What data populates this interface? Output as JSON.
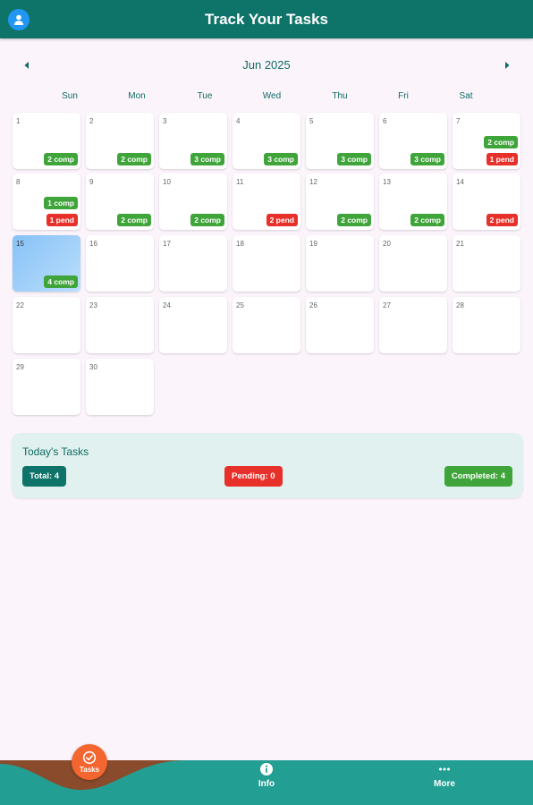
{
  "appbar": {
    "title": "Track Your Tasks",
    "avatar_icon": "person-icon"
  },
  "calendar": {
    "month_label": "Jun 2025",
    "prev_icon": "chevron-left-icon",
    "next_icon": "chevron-right-icon",
    "weekdays": [
      "Sun",
      "Mon",
      "Tue",
      "Wed",
      "Thu",
      "Fri",
      "Sat"
    ],
    "days": [
      {
        "day": "1",
        "comp": "2 comp"
      },
      {
        "day": "2",
        "comp": "2 comp"
      },
      {
        "day": "3",
        "comp": "3 comp"
      },
      {
        "day": "4",
        "comp": "3 comp"
      },
      {
        "day": "5",
        "comp": "3 comp"
      },
      {
        "day": "6",
        "comp": "3 comp"
      },
      {
        "day": "7",
        "comp": "2 comp",
        "pend": "1 pend"
      },
      {
        "day": "8",
        "comp": "1 comp",
        "pend": "1 pend"
      },
      {
        "day": "9",
        "comp": "2 comp"
      },
      {
        "day": "10",
        "comp": "2 comp"
      },
      {
        "day": "11",
        "pend": "2 pend"
      },
      {
        "day": "12",
        "comp": "2 comp"
      },
      {
        "day": "13",
        "comp": "2 comp"
      },
      {
        "day": "14",
        "pend": "2 pend"
      },
      {
        "day": "15",
        "comp": "4 comp",
        "today": true
      },
      {
        "day": "16"
      },
      {
        "day": "17"
      },
      {
        "day": "18"
      },
      {
        "day": "19"
      },
      {
        "day": "20"
      },
      {
        "day": "21"
      },
      {
        "day": "22"
      },
      {
        "day": "23"
      },
      {
        "day": "24"
      },
      {
        "day": "25"
      },
      {
        "day": "26"
      },
      {
        "day": "27"
      },
      {
        "day": "28"
      },
      {
        "day": "29"
      },
      {
        "day": "30"
      }
    ]
  },
  "summary": {
    "title": "Today's Tasks",
    "total": "Total: 4",
    "pending": "Pending: 0",
    "completed": "Completed: 4"
  },
  "bottom_nav": {
    "items": [
      {
        "label": "Tasks",
        "icon": "check-circle-icon",
        "active": true
      },
      {
        "label": "Info",
        "icon": "info-icon"
      },
      {
        "label": "More",
        "icon": "more-horizontal-icon"
      }
    ]
  },
  "colors": {
    "primary": "#0E7469",
    "accent": "#F4662F",
    "completed": "#3FA53A",
    "pending": "#E8302A",
    "today": "#86C2F7",
    "nav": "#239E93"
  }
}
